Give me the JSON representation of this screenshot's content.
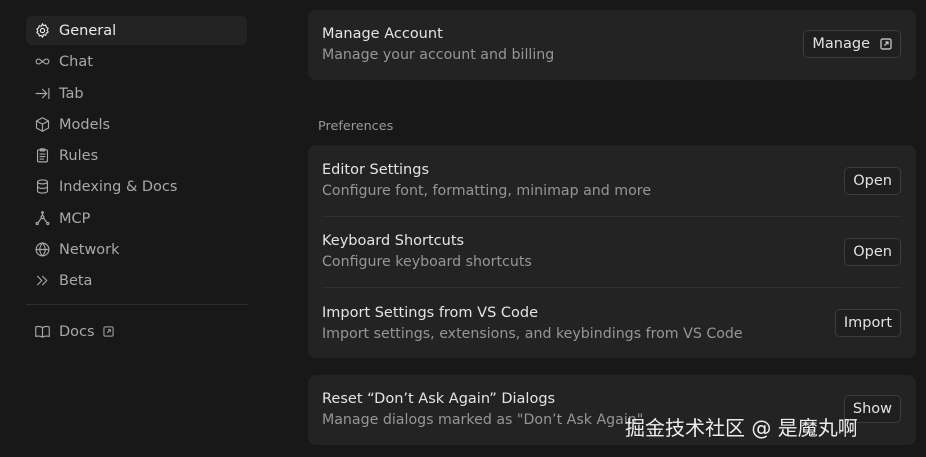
{
  "sidebar": {
    "items": [
      {
        "label": "General",
        "icon": "gear-icon"
      },
      {
        "label": "Chat",
        "icon": "infinity-icon"
      },
      {
        "label": "Tab",
        "icon": "tab-arrow-icon"
      },
      {
        "label": "Models",
        "icon": "cube-icon"
      },
      {
        "label": "Rules",
        "icon": "clipboard-icon"
      },
      {
        "label": "Indexing & Docs",
        "icon": "database-icon"
      },
      {
        "label": "MCP",
        "icon": "network-node-icon"
      },
      {
        "label": "Network",
        "icon": "globe-icon"
      },
      {
        "label": "Beta",
        "icon": "double-chevron-icon"
      }
    ],
    "docs": {
      "label": "Docs",
      "icon": "book-icon"
    }
  },
  "account": {
    "title": "Manage Account",
    "desc": "Manage your account and billing",
    "button": "Manage"
  },
  "preferences": {
    "label": "Preferences",
    "rows": [
      {
        "title": "Editor Settings",
        "desc": "Configure font, formatting, minimap and more",
        "button": "Open"
      },
      {
        "title": "Keyboard Shortcuts",
        "desc": "Configure keyboard shortcuts",
        "button": "Open"
      },
      {
        "title": "Import Settings from VS Code",
        "desc": "Import settings, extensions, and keybindings from VS Code",
        "button": "Import"
      }
    ]
  },
  "dialogs": {
    "title": "Reset “Don’t Ask Again” Dialogs",
    "desc": "Manage dialogs marked as \"Don’t Ask Again\"",
    "button": "Show"
  },
  "watermark": "掘金技术社区 @ 是魔丸啊",
  "colors": {
    "background": "#181818",
    "card": "#232323",
    "active_nav": "#232323"
  }
}
